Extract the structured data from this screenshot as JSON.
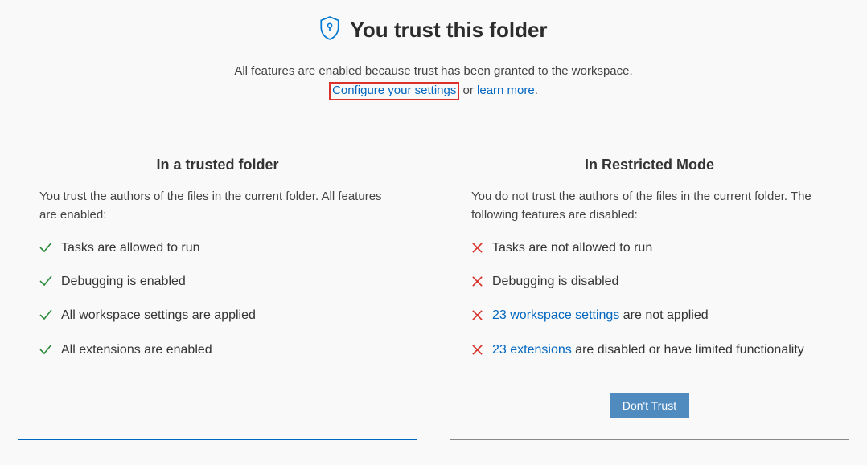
{
  "header": {
    "title": "You trust this folder",
    "subtitle1": "All features are enabled because trust has been granted to the workspace.",
    "configure_link": "Configure your settings",
    "or_text": " or ",
    "learn_more_link": "learn more",
    "period": "."
  },
  "trusted_card": {
    "title": "In a trusted folder",
    "subtitle": "You trust the authors of the files in the current folder. All features are enabled:",
    "features": [
      "Tasks are allowed to run",
      "Debugging is enabled",
      "All workspace settings are applied",
      "All extensions are enabled"
    ]
  },
  "restricted_card": {
    "title": "In Restricted Mode",
    "subtitle": "You do not trust the authors of the files in the current folder. The following features are disabled:",
    "features": [
      {
        "text": "Tasks are not allowed to run"
      },
      {
        "text": "Debugging is disabled"
      },
      {
        "link": "23 workspace settings",
        "tail": " are not applied"
      },
      {
        "link": "23 extensions",
        "tail": " are disabled or have limited functionality"
      }
    ],
    "dont_trust_button": "Don't Trust"
  }
}
